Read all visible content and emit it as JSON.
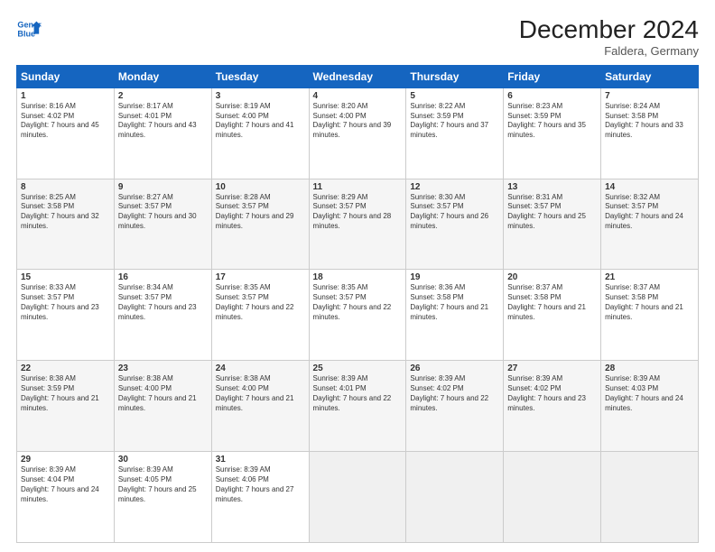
{
  "header": {
    "logo_line1": "General",
    "logo_line2": "Blue",
    "title": "December 2024",
    "subtitle": "Faldera, Germany"
  },
  "columns": [
    "Sunday",
    "Monday",
    "Tuesday",
    "Wednesday",
    "Thursday",
    "Friday",
    "Saturday"
  ],
  "weeks": [
    [
      {
        "day": "1",
        "sunrise": "Sunrise: 8:16 AM",
        "sunset": "Sunset: 4:02 PM",
        "daylight": "Daylight: 7 hours and 45 minutes."
      },
      {
        "day": "2",
        "sunrise": "Sunrise: 8:17 AM",
        "sunset": "Sunset: 4:01 PM",
        "daylight": "Daylight: 7 hours and 43 minutes."
      },
      {
        "day": "3",
        "sunrise": "Sunrise: 8:19 AM",
        "sunset": "Sunset: 4:00 PM",
        "daylight": "Daylight: 7 hours and 41 minutes."
      },
      {
        "day": "4",
        "sunrise": "Sunrise: 8:20 AM",
        "sunset": "Sunset: 4:00 PM",
        "daylight": "Daylight: 7 hours and 39 minutes."
      },
      {
        "day": "5",
        "sunrise": "Sunrise: 8:22 AM",
        "sunset": "Sunset: 3:59 PM",
        "daylight": "Daylight: 7 hours and 37 minutes."
      },
      {
        "day": "6",
        "sunrise": "Sunrise: 8:23 AM",
        "sunset": "Sunset: 3:59 PM",
        "daylight": "Daylight: 7 hours and 35 minutes."
      },
      {
        "day": "7",
        "sunrise": "Sunrise: 8:24 AM",
        "sunset": "Sunset: 3:58 PM",
        "daylight": "Daylight: 7 hours and 33 minutes."
      }
    ],
    [
      {
        "day": "8",
        "sunrise": "Sunrise: 8:25 AM",
        "sunset": "Sunset: 3:58 PM",
        "daylight": "Daylight: 7 hours and 32 minutes."
      },
      {
        "day": "9",
        "sunrise": "Sunrise: 8:27 AM",
        "sunset": "Sunset: 3:57 PM",
        "daylight": "Daylight: 7 hours and 30 minutes."
      },
      {
        "day": "10",
        "sunrise": "Sunrise: 8:28 AM",
        "sunset": "Sunset: 3:57 PM",
        "daylight": "Daylight: 7 hours and 29 minutes."
      },
      {
        "day": "11",
        "sunrise": "Sunrise: 8:29 AM",
        "sunset": "Sunset: 3:57 PM",
        "daylight": "Daylight: 7 hours and 28 minutes."
      },
      {
        "day": "12",
        "sunrise": "Sunrise: 8:30 AM",
        "sunset": "Sunset: 3:57 PM",
        "daylight": "Daylight: 7 hours and 26 minutes."
      },
      {
        "day": "13",
        "sunrise": "Sunrise: 8:31 AM",
        "sunset": "Sunset: 3:57 PM",
        "daylight": "Daylight: 7 hours and 25 minutes."
      },
      {
        "day": "14",
        "sunrise": "Sunrise: 8:32 AM",
        "sunset": "Sunset: 3:57 PM",
        "daylight": "Daylight: 7 hours and 24 minutes."
      }
    ],
    [
      {
        "day": "15",
        "sunrise": "Sunrise: 8:33 AM",
        "sunset": "Sunset: 3:57 PM",
        "daylight": "Daylight: 7 hours and 23 minutes."
      },
      {
        "day": "16",
        "sunrise": "Sunrise: 8:34 AM",
        "sunset": "Sunset: 3:57 PM",
        "daylight": "Daylight: 7 hours and 23 minutes."
      },
      {
        "day": "17",
        "sunrise": "Sunrise: 8:35 AM",
        "sunset": "Sunset: 3:57 PM",
        "daylight": "Daylight: 7 hours and 22 minutes."
      },
      {
        "day": "18",
        "sunrise": "Sunrise: 8:35 AM",
        "sunset": "Sunset: 3:57 PM",
        "daylight": "Daylight: 7 hours and 22 minutes."
      },
      {
        "day": "19",
        "sunrise": "Sunrise: 8:36 AM",
        "sunset": "Sunset: 3:58 PM",
        "daylight": "Daylight: 7 hours and 21 minutes."
      },
      {
        "day": "20",
        "sunrise": "Sunrise: 8:37 AM",
        "sunset": "Sunset: 3:58 PM",
        "daylight": "Daylight: 7 hours and 21 minutes."
      },
      {
        "day": "21",
        "sunrise": "Sunrise: 8:37 AM",
        "sunset": "Sunset: 3:58 PM",
        "daylight": "Daylight: 7 hours and 21 minutes."
      }
    ],
    [
      {
        "day": "22",
        "sunrise": "Sunrise: 8:38 AM",
        "sunset": "Sunset: 3:59 PM",
        "daylight": "Daylight: 7 hours and 21 minutes."
      },
      {
        "day": "23",
        "sunrise": "Sunrise: 8:38 AM",
        "sunset": "Sunset: 4:00 PM",
        "daylight": "Daylight: 7 hours and 21 minutes."
      },
      {
        "day": "24",
        "sunrise": "Sunrise: 8:38 AM",
        "sunset": "Sunset: 4:00 PM",
        "daylight": "Daylight: 7 hours and 21 minutes."
      },
      {
        "day": "25",
        "sunrise": "Sunrise: 8:39 AM",
        "sunset": "Sunset: 4:01 PM",
        "daylight": "Daylight: 7 hours and 22 minutes."
      },
      {
        "day": "26",
        "sunrise": "Sunrise: 8:39 AM",
        "sunset": "Sunset: 4:02 PM",
        "daylight": "Daylight: 7 hours and 22 minutes."
      },
      {
        "day": "27",
        "sunrise": "Sunrise: 8:39 AM",
        "sunset": "Sunset: 4:02 PM",
        "daylight": "Daylight: 7 hours and 23 minutes."
      },
      {
        "day": "28",
        "sunrise": "Sunrise: 8:39 AM",
        "sunset": "Sunset: 4:03 PM",
        "daylight": "Daylight: 7 hours and 24 minutes."
      }
    ],
    [
      {
        "day": "29",
        "sunrise": "Sunrise: 8:39 AM",
        "sunset": "Sunset: 4:04 PM",
        "daylight": "Daylight: 7 hours and 24 minutes."
      },
      {
        "day": "30",
        "sunrise": "Sunrise: 8:39 AM",
        "sunset": "Sunset: 4:05 PM",
        "daylight": "Daylight: 7 hours and 25 minutes."
      },
      {
        "day": "31",
        "sunrise": "Sunrise: 8:39 AM",
        "sunset": "Sunset: 4:06 PM",
        "daylight": "Daylight: 7 hours and 27 minutes."
      },
      null,
      null,
      null,
      null
    ]
  ]
}
